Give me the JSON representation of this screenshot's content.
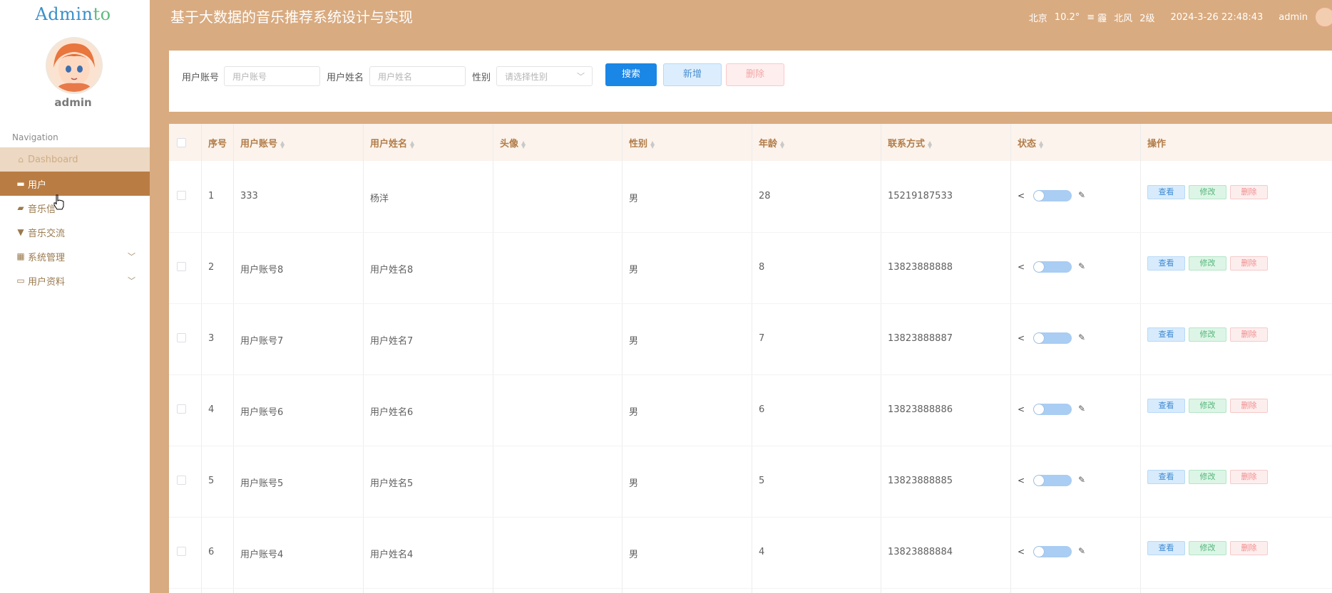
{
  "brand": {
    "logo_text_a": "Admin",
    "logo_text_b": "to"
  },
  "user": {
    "name": "admin"
  },
  "sidebar": {
    "nav_label": "Navigation",
    "items": [
      {
        "label": "Dashboard",
        "icon": "home-icon"
      },
      {
        "label": "用户",
        "icon": "user-card-icon"
      },
      {
        "label": "音乐信",
        "icon": "thumbs-icon"
      },
      {
        "label": "音乐交流",
        "icon": "pin-icon"
      },
      {
        "label": "系统管理",
        "icon": "grid-icon"
      },
      {
        "label": "用户资料",
        "icon": "calendar-icon"
      }
    ]
  },
  "header": {
    "title": "基于大数据的音乐推荐系统设计与实现",
    "city": "北京",
    "temp": "10.2°",
    "weather_icon": "fog-icon",
    "weather": "霾",
    "wind": "北风",
    "wind_level": "2级",
    "datetime": "2024-3-26 22:48:43",
    "user": "admin"
  },
  "search": {
    "account_label": "用户账号",
    "account_placeholder": "用户账号",
    "name_label": "用户姓名",
    "name_placeholder": "用户姓名",
    "gender_label": "性别",
    "gender_placeholder": "请选择性别",
    "search_btn": "搜索",
    "add_btn": "新增",
    "delete_btn": "删除"
  },
  "table": {
    "headers": {
      "index": "序号",
      "account": "用户账号",
      "name": "用户姓名",
      "avatar": "头像",
      "gender": "性别",
      "age": "年龄",
      "phone": "联系方式",
      "status": "状态",
      "ops": "操作"
    },
    "op_labels": {
      "view": "查看",
      "edit": "修改",
      "delete": "删除"
    },
    "rows": [
      {
        "index": "1",
        "account": "333",
        "name": "杨洋",
        "gender": "男",
        "age": "28",
        "phone": "15219187533"
      },
      {
        "index": "2",
        "account": "用户账号8",
        "name": "用户姓名8",
        "gender": "男",
        "age": "8",
        "phone": "13823888888"
      },
      {
        "index": "3",
        "account": "用户账号7",
        "name": "用户姓名7",
        "gender": "男",
        "age": "7",
        "phone": "13823888887"
      },
      {
        "index": "4",
        "account": "用户账号6",
        "name": "用户姓名6",
        "gender": "男",
        "age": "6",
        "phone": "13823888886"
      },
      {
        "index": "5",
        "account": "用户账号5",
        "name": "用户姓名5",
        "gender": "男",
        "age": "5",
        "phone": "13823888885"
      },
      {
        "index": "6",
        "account": "用户账号4",
        "name": "用户姓名4",
        "gender": "男",
        "age": "4",
        "phone": "13823888884"
      }
    ]
  },
  "colors": {
    "header_bg": "#d9ab80",
    "active_menu": "#b97d44",
    "primary": "#1a86e5"
  }
}
